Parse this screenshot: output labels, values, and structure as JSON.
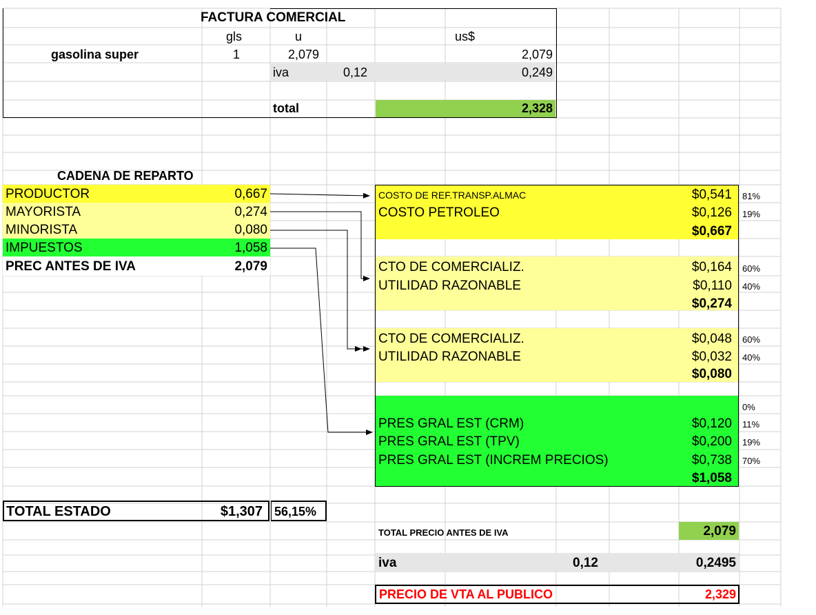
{
  "factura": {
    "title": "FACTURA COMERCIAL",
    "col_gls": "gls",
    "col_u": "u",
    "col_usd": "us$",
    "product": "gasolina super",
    "qty": "1",
    "unit_price": "2,079",
    "amount": "2,079",
    "iva_label": "iva",
    "iva_rate": "0,12",
    "iva_amount": "0,249",
    "total_label": "total",
    "total_value": "2,328"
  },
  "cadena": {
    "title": "CADENA DE REPARTO",
    "rows": [
      {
        "label": "PRODUCTOR",
        "value": "0,667",
        "bg": "#ffff33"
      },
      {
        "label": "MAYORISTA",
        "value": "0,274",
        "bg": "#ffff99"
      },
      {
        "label": "MINORISTA",
        "value": "0,080",
        "bg": "#ffff99"
      },
      {
        "label": "IMPUESTOS",
        "value": "1,058",
        "bg": "#22ff33"
      }
    ],
    "total_label": "PREC ANTES DE IVA",
    "total_value": "2,079"
  },
  "detalle": {
    "productor": {
      "line1_label": "COSTO DE REF.TRANSP.ALMAC",
      "line1_value": "$0,541",
      "line1_pct": "81%",
      "line2_label": "COSTO PETROLEO",
      "line2_value": "$0,126",
      "line2_pct": "19%",
      "subtotal": "$0,667"
    },
    "mayorista": {
      "line1_label": "CTO DE COMERCIALIZ.",
      "line1_value": "$0,164",
      "line1_pct": "60%",
      "line2_label": "UTILIDAD RAZONABLE",
      "line2_value": "$0,110",
      "line2_pct": "40%",
      "subtotal": "$0,274"
    },
    "minorista": {
      "line1_label": "CTO DE COMERCIALIZ.",
      "line1_value": "$0,048",
      "line1_pct": "60%",
      "line2_label": "UTILIDAD RAZONABLE",
      "line2_value": "$0,032",
      "line2_pct": "40%",
      "subtotal": "$0,080"
    },
    "impuestos": {
      "top_pct": "0%",
      "line1_label": "PRES GRAL EST (CRM)",
      "line1_value": "$0,120",
      "line1_pct": "11%",
      "line2_label": "PRES GRAL EST (TPV)",
      "line2_value": "$0,200",
      "line2_pct": "19%",
      "line3_label": "PRES GRAL EST  (INCREM PRECIOS)",
      "line3_value": "$0,738",
      "line3_pct": "70%",
      "subtotal": "$1,058"
    }
  },
  "total_estado": {
    "label": "TOTAL ESTADO",
    "value": "$1,307",
    "pct": "56,15%"
  },
  "resumen": {
    "total_label": "TOTAL PRECIO ANTES DE IVA",
    "total_value": "2,079",
    "iva_label": "iva",
    "iva_rate": "0,12",
    "iva_value": "0,2495",
    "precio_label": "PRECIO DE VTA AL PUBLICO",
    "precio_value": "2,329"
  },
  "colors": {
    "yellow_strong": "#ffff33",
    "yellow_light": "#ffff99",
    "green_bright": "#22ff33",
    "green_total": "#92d050",
    "gray_band": "#e6e6e6",
    "red": "#ff0000"
  }
}
